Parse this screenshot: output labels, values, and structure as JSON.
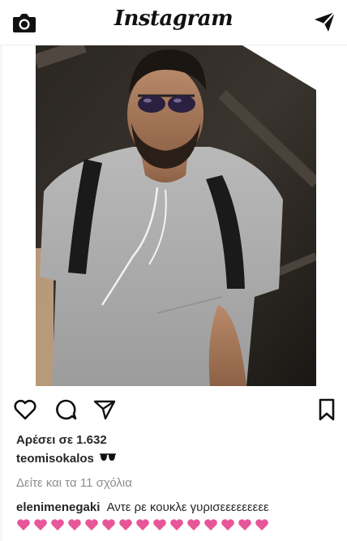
{
  "app": {
    "title": "Instagram",
    "icons": {
      "camera": "camera-icon",
      "direct": "direct-send-icon"
    }
  },
  "post": {
    "image_description_icon": "photo",
    "actions": {
      "like": "heart-icon",
      "comment": "comment-icon",
      "share": "share-icon",
      "save": "bookmark-icon"
    },
    "likes_text": "Αρέσει σε 1.632",
    "caption": {
      "username": "teomisokalos",
      "emoji_icon": "sunglasses-icon"
    },
    "view_comments_text": "Δείτε και τα 11 σχόλια",
    "comment": {
      "username": "elenimenegaki",
      "text": "Αντε ρε κουκλε γυρισεεεεεεεεε",
      "heart_count": 15,
      "heart_color": "#e8569a"
    }
  },
  "colors": {
    "text": "#262626",
    "muted": "#8e8e8e",
    "divider": "#efefef"
  }
}
